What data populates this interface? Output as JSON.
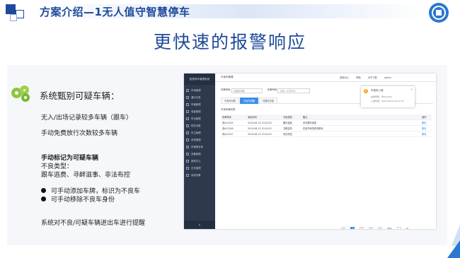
{
  "header": {
    "title": "方案介绍—1无人值守智慧停车",
    "subtitle": "更快速的报警响应"
  },
  "left": {
    "heading": "系统甄别可疑车辆：",
    "line1": "无入/出场记录较多车辆（跟车）",
    "line2": "手动免费放行次数较多车辆",
    "line3": "手动标记为可疑车辆",
    "line4": "不良类型：",
    "line5": "跟车逃费、寻衅滋事、非法布控",
    "bullet1": "可手动添加车牌，标识为不良车",
    "bullet2": "可手动移除不良车身份",
    "line6": "系统对不良/可疑车辆进出车进行提醒"
  },
  "app": {
    "sidebar_title": "智慧停车管理系统",
    "sidebar_items": [
      "车场管理",
      "通行记录",
      "车辆管理",
      "收费管理",
      "车位管理",
      "财务对账",
      "车主管理",
      "系统管理",
      "车辆黑名单",
      "设备管理",
      "报表中心",
      "日志管理",
      "系统设置"
    ],
    "breadcrumb": "不良车管理",
    "top_icons": [
      "视频中心",
      "帮助",
      "APP下载",
      "admin"
    ],
    "filter_label1": "车牌号码",
    "filter_placeholder1": "请选择车牌",
    "filter_label2": "车牌号码",
    "filter_placeholder2": "请输入车牌号码",
    "tabs": [
      "不良车列表",
      "不良车提醒",
      "可疑车记录"
    ],
    "table_caption": "不良车辆列表",
    "buttons": [
      "新增",
      "导出"
    ],
    "columns": [
      "车牌号码",
      "添加时间",
      "不良类型",
      "备注",
      "操作"
    ],
    "rows": [
      [
        "粤A12345",
        "2019-06-14 10:20:22",
        "跟车逃费",
        "多次跟车逃费",
        "删除"
      ],
      [
        "粤A12346",
        "2019-06-13 10:20:22",
        "寻衅滋事",
        "在岗亭闹事影响秩序",
        "删除"
      ],
      [
        "粤A12347",
        "2019-06-12 10:20:22",
        "非法布控",
        "",
        "删除"
      ]
    ],
    "pager": [
      "<",
      "1",
      "2",
      "3",
      ">",
      "跳至",
      "页"
    ],
    "notice": {
      "title": "不良车入场",
      "line1": "车牌号码：粤A12345",
      "line2": "入场时间：2019-06-14 09:12:22",
      "close": "×"
    },
    "collapse": "‹"
  }
}
